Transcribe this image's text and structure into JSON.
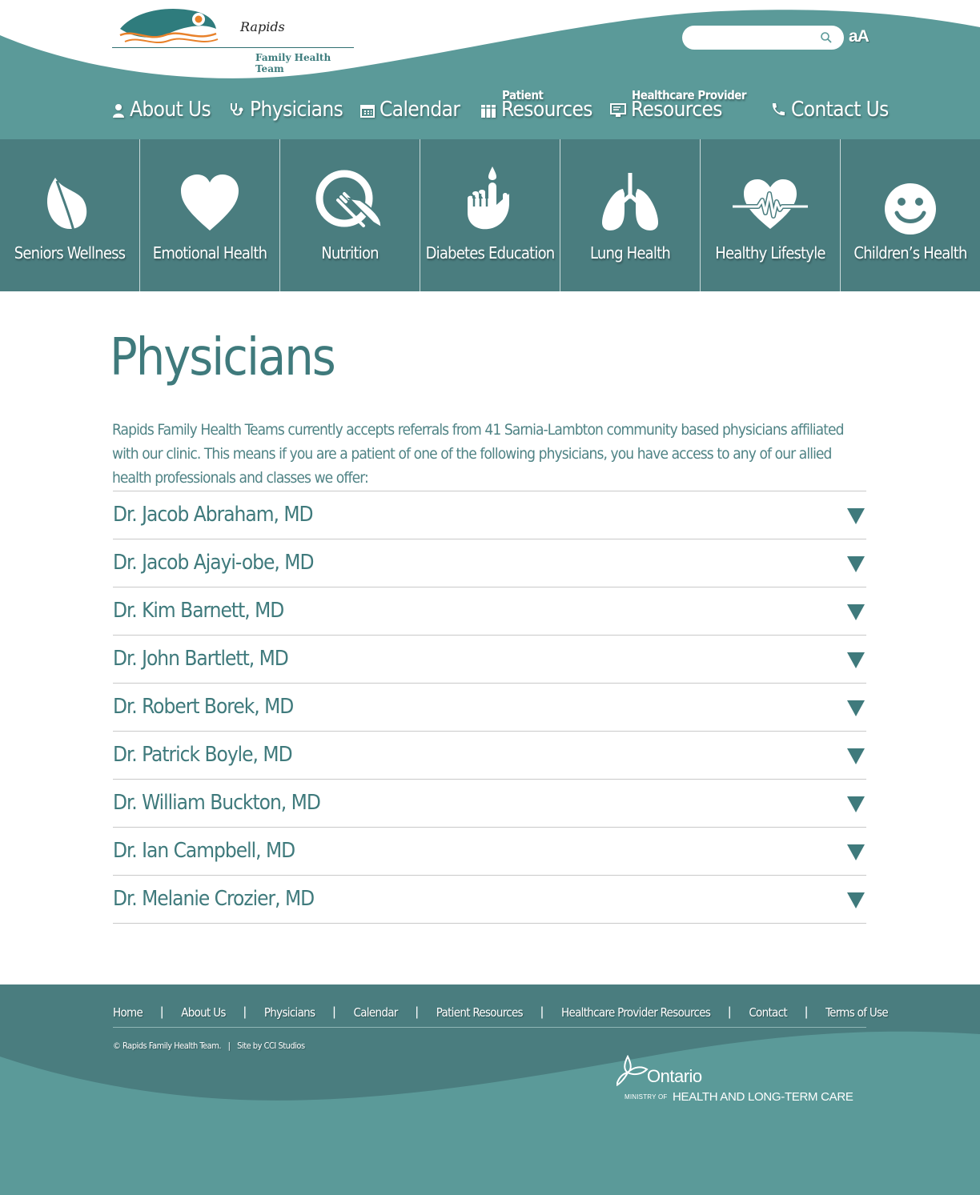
{
  "brand": {
    "name_script": "Rapids",
    "name_sub": "Family Health Team",
    "colors": {
      "teal_dark": "#4a7d7f",
      "teal_light": "#5b9a99",
      "orange": "#e8812a",
      "text": "#3f7a7c"
    }
  },
  "search": {
    "placeholder": "",
    "icon": "search-icon"
  },
  "text_size_label": "aA",
  "nav": [
    {
      "label": "About Us",
      "sup": "",
      "icon": "person-icon"
    },
    {
      "label": "Physicians",
      "sup": "",
      "icon": "stethoscope-icon"
    },
    {
      "label": "Calendar",
      "sup": "",
      "icon": "calendar-icon"
    },
    {
      "label": "Resources",
      "sup": "Patient",
      "icon": "books-icon"
    },
    {
      "label": "Resources",
      "sup": "Healthcare Provider",
      "icon": "monitor-icon"
    },
    {
      "label": "Contact Us",
      "sup": "",
      "icon": "phone-icon"
    }
  ],
  "tiles": [
    {
      "label": "Seniors Wellness",
      "icon": "leaf-icon"
    },
    {
      "label": "Emotional Health",
      "icon": "heart-icon"
    },
    {
      "label": "Nutrition",
      "icon": "plate-fork-knife-icon"
    },
    {
      "label": "Diabetes Education",
      "icon": "finger-drop-icon"
    },
    {
      "label": "Lung Health",
      "icon": "lungs-icon"
    },
    {
      "label": "Healthy Lifestyle",
      "icon": "heartbeat-icon"
    },
    {
      "label": "Children’s Health",
      "icon": "smiley-icon"
    }
  ],
  "page": {
    "title": "Physicians",
    "intro": "Rapids Family Health Teams currently accepts referrals from 41 Sarnia-Lambton community based physicians affiliated with our clinic. This means if you are a patient of one of the following physicians, you have access to any of our allied health professionals and classes we offer:"
  },
  "physicians": [
    "Dr. Jacob Abraham, MD",
    "Dr. Jacob Ajayi-obe, MD",
    "Dr. Kim Barnett, MD",
    "Dr. John Bartlett, MD",
    "Dr. Robert Borek, MD",
    "Dr. Patrick Boyle, MD",
    "Dr. William Buckton, MD",
    "Dr. Ian Campbell, MD",
    "Dr. Melanie Crozier, MD"
  ],
  "footer": {
    "links": [
      "Home",
      "About Us",
      "Physicians",
      "Calendar",
      "Patient Resources",
      "Healthcare Provider Resources",
      "Contact",
      "Terms of Use"
    ],
    "separator": "|",
    "copyright": "© Rapids Family Health Team.",
    "site_by": "Site by CCI Studios",
    "ontario_name": "Ontario",
    "ontario_ministry": "MINISTRY OF",
    "ontario_dept": "HEALTH AND LONG-TERM CARE"
  }
}
